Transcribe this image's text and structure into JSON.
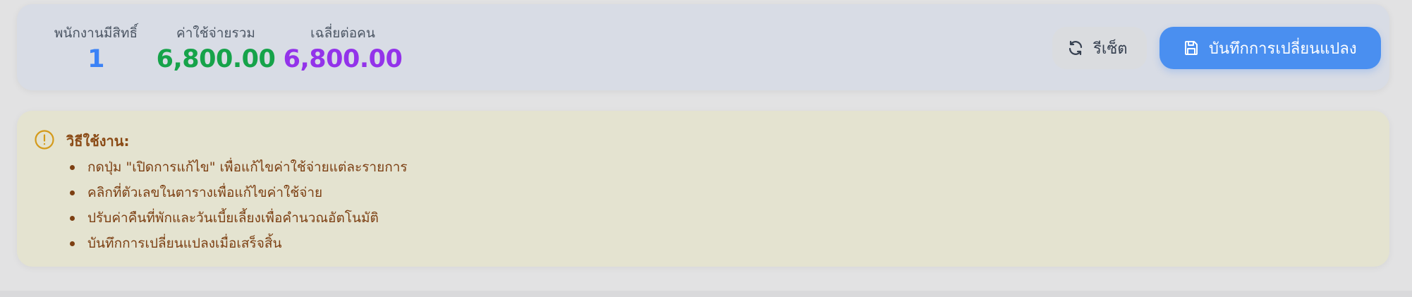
{
  "summary": {
    "stats": [
      {
        "label": "พนักงานมีสิทธิ์",
        "value": "1",
        "color": "#3b82f6"
      },
      {
        "label": "ค่าใช้จ่ายรวม",
        "value": "6,800.00",
        "color": "#16a34a"
      },
      {
        "label": "เฉลี่ยต่อคน",
        "value": "6,800.00",
        "color": "#9333ea"
      }
    ],
    "reset_button": {
      "label": "รีเซ็ต",
      "icon": "refresh-icon"
    },
    "save_button": {
      "label": "บันทึกการเปลี่ยนแปลง",
      "icon": "save-icon"
    }
  },
  "instructions": {
    "icon": "alert-circle-icon",
    "title": "วิธีใช้งาน:",
    "items": [
      "กดปุ่ม \"เปิดการแก้ไข\" เพื่อแก้ไขค่าใช้จ่ายแต่ละรายการ",
      "คลิกที่ตัวเลขในตารางเพื่อแก้ไขค่าใช้จ่าย",
      "ปรับค่าคืนที่พักและวันเบี้ยเลี้ยงเพื่อคำนวณอัตโนมัติ",
      "บันทึกการเปลี่ยนแปลงเมื่อเสร็จสิ้น"
    ]
  },
  "colors": {
    "accent": "#4a8ff0",
    "info_text": "#7c3f12",
    "info_icon": "#d49a1a"
  }
}
